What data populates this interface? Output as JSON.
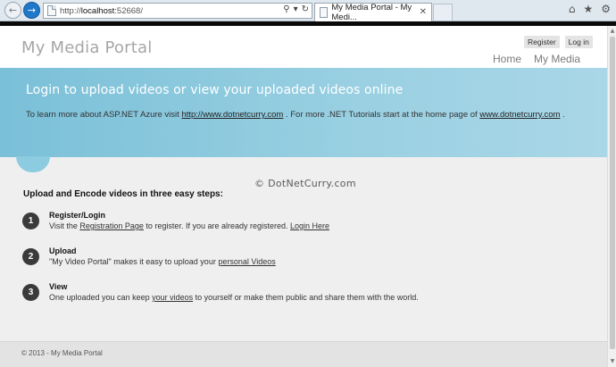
{
  "browser": {
    "url_prefix": "http://",
    "url_host": "localhost",
    "url_port": ":52668/",
    "tab_title": "My Media Portal - My Medi...",
    "back_glyph": "←",
    "forward_glyph": "→",
    "close_glyph": "✕",
    "home_glyph": "⌂",
    "star_glyph": "★",
    "gear_glyph": "⚙",
    "search_glyph": "⚲",
    "dropdown_glyph": "▾",
    "refresh_glyph": "↻"
  },
  "header": {
    "site_title": "My Media Portal",
    "register": "Register",
    "login": "Log in",
    "nav": [
      "Home",
      "My Media"
    ]
  },
  "banner": {
    "title": "Login to upload videos or view your uploaded videos online",
    "text_before": "To learn more about ASP.NET Azure visit ",
    "link1": "http://www.dotnetcurry.com",
    "text_middle": " . For more .NET Tutorials start at the home page of ",
    "link2": "www.dotnetcurry.com",
    "text_after": " ."
  },
  "content": {
    "watermark": "© DotNetCurry.com",
    "heading": "Upload and Encode videos in three easy steps:",
    "steps": [
      {
        "number": "1",
        "title": "Register/Login",
        "desc_before": "Visit the ",
        "link": "Registration Page",
        "desc_middle": " to register. If you are already registered. ",
        "link2": "Login Here",
        "desc_after": ""
      },
      {
        "number": "2",
        "title": "Upload",
        "desc_before": "\"My Video Portal\" makes it easy to upload your ",
        "link": "personal Videos",
        "desc_after": ""
      },
      {
        "number": "3",
        "title": "View",
        "desc_before": "One uploaded you can keep ",
        "link": "your videos",
        "desc_after": " to yourself or make them public and share them with the world."
      }
    ]
  },
  "footer": {
    "text": "© 2013 - My Media Portal"
  },
  "colors": {
    "banner": "#8ccbe0",
    "site_title": "#a6a6a6",
    "content_bg": "#efefef",
    "footer_bg": "#e3e3e3"
  }
}
